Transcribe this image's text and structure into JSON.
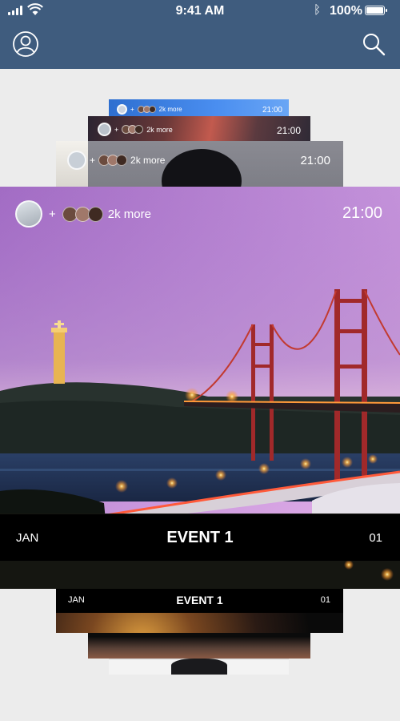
{
  "status_bar": {
    "time": "9:41 AM",
    "battery": "100%",
    "battery_level": 1.0
  },
  "header": {
    "profile_icon": "user-circle-icon",
    "search_icon": "search-icon",
    "color": "#3f5c7e"
  },
  "events": [
    {
      "month": "JAN",
      "title": "EVENT 1",
      "number": "01",
      "time": "21:00",
      "attendees_more": "2k more",
      "plus": "+"
    }
  ],
  "stack_cards": [
    {
      "time": "21:00",
      "attendees_more": "2k more",
      "plus": "+"
    },
    {
      "time": "21:00",
      "attendees_more": "2k more",
      "plus": "+"
    },
    {
      "time": "21:00",
      "attendees_more": "2k more",
      "plus": "+"
    }
  ],
  "below_cards": [
    {
      "month": "JAN",
      "title": "EVENT 1",
      "number": "01"
    }
  ]
}
